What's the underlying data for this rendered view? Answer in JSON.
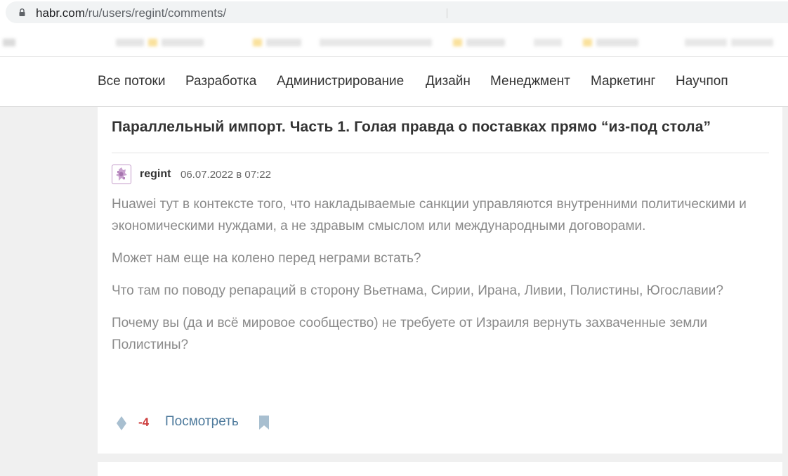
{
  "browser": {
    "url_host": "habr.com",
    "url_path": "/ru/users/regint/comments/",
    "lock_icon": "lock-icon"
  },
  "nav": {
    "items": [
      "Все потоки",
      "Разработка",
      "Администрирование",
      "Дизайн",
      "Менеджмент",
      "Маркетинг",
      "Научпоп"
    ]
  },
  "comment": {
    "post_title": "Параллельный импорт. Часть 1. Голая правда о поставках прямо “из-под стола”",
    "author": "regint",
    "date": "06.07.2022 в 07:22",
    "paragraphs": [
      "Huawei тут в контексте того, что накладываемые санкции управляются внутренними политическими и экономическими нуждами, а не здравым смыслом или международными договорами.",
      "Может нам еще на колено перед неграми встать?",
      "Что там по поводу репараций в сторону Вьетнама, Сирии, Ирана, Ливии, Полистины, Югославии?",
      "Почему вы (да и всё мировое сообщество) не требуете от Израиля вернуть захваченные земли Полистины?"
    ],
    "score": "-4",
    "view_label": "Посмотреть",
    "score_color": "#cc3b3b",
    "link_color": "#4e7a9c"
  }
}
